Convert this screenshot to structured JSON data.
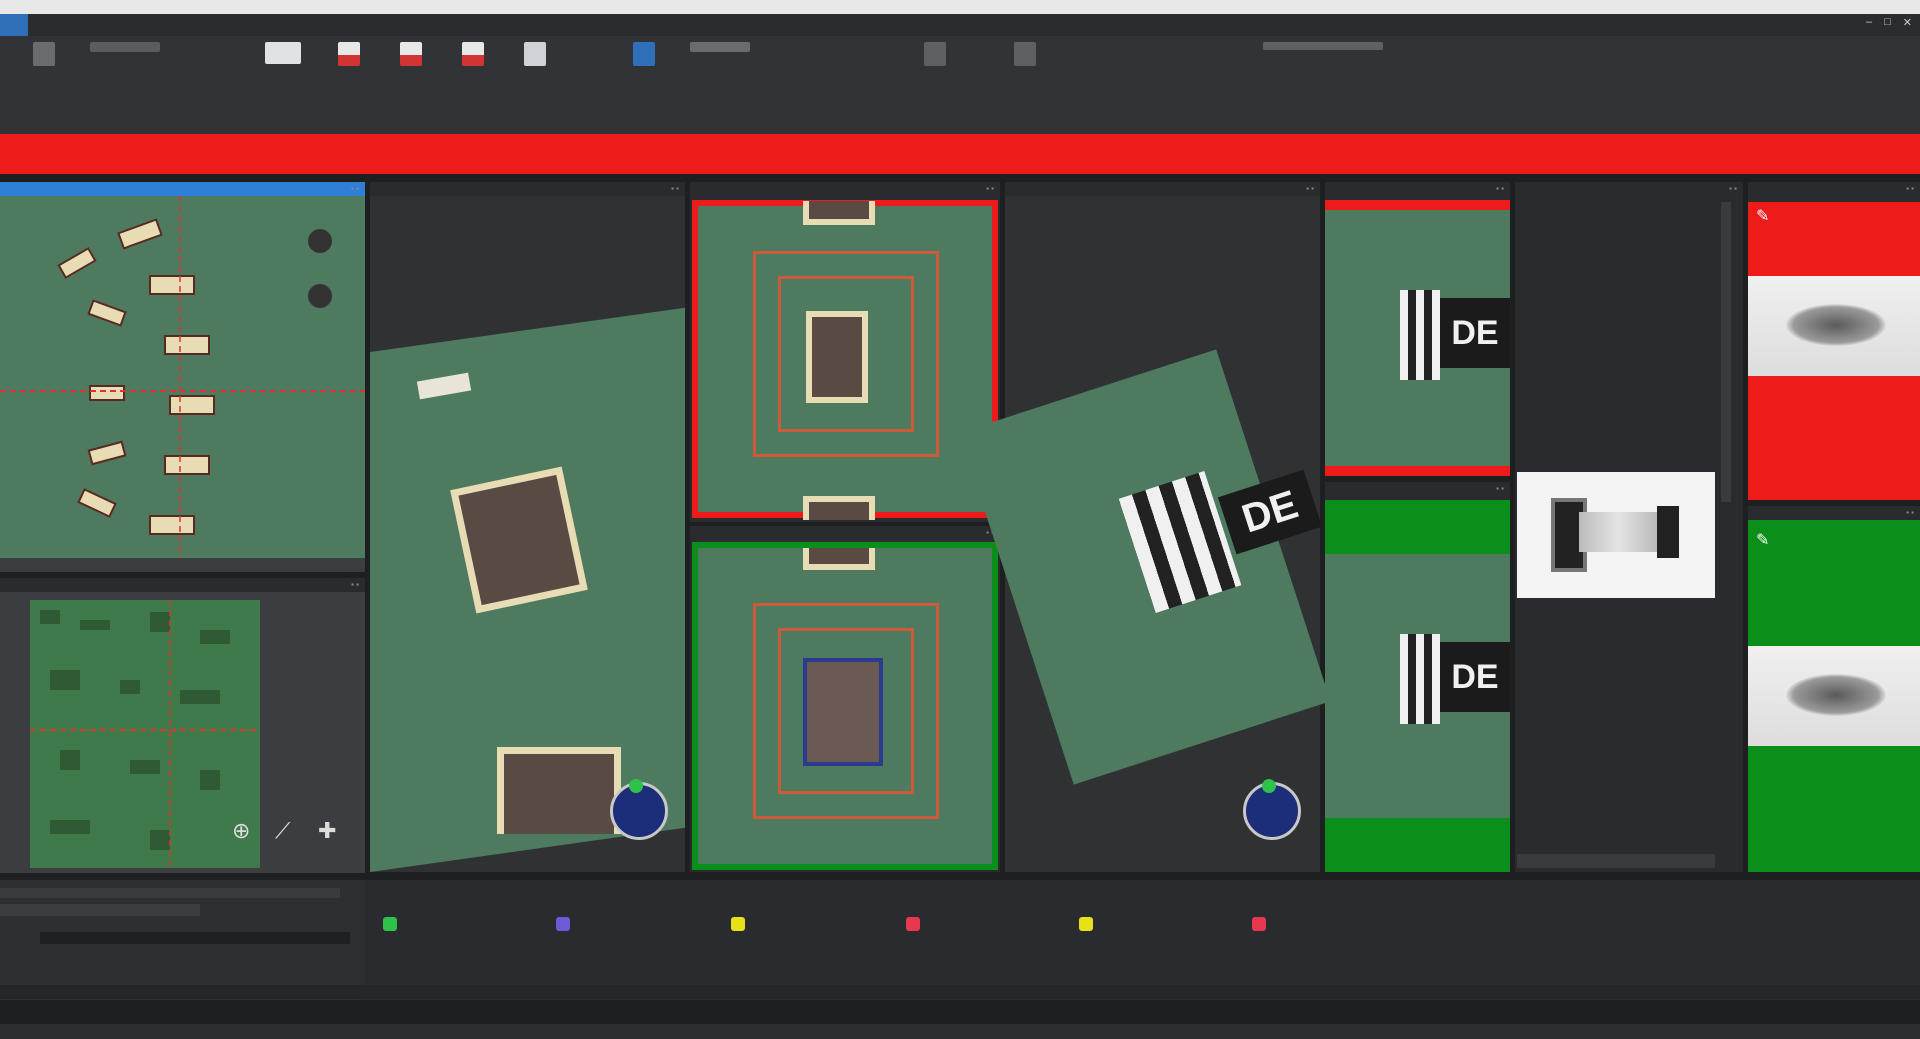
{
  "window": {
    "title": "",
    "controls": [
      "–",
      "□",
      "✕"
    ]
  },
  "menu": {
    "tabs": [
      "",
      "",
      "",
      ""
    ]
  },
  "ribbon": {
    "groups": [
      {
        "label": ""
      },
      {
        "label": ""
      },
      {
        "label": ""
      },
      {
        "label": ""
      }
    ],
    "buttons": [
      "",
      "",
      "",
      "",
      "",
      "",
      "",
      "",
      "",
      "",
      "",
      ""
    ]
  },
  "alert": {
    "text": ""
  },
  "panels": {
    "overview": {
      "title": ""
    },
    "board_map": {
      "title": ""
    },
    "view1": {
      "title": ""
    },
    "view2_top": {
      "title": ""
    },
    "view2_bottom": {
      "title": ""
    },
    "view3": {
      "title": ""
    },
    "view4_top": {
      "title": ""
    },
    "view4_bottom": {
      "title": ""
    },
    "view5": {
      "title": ""
    },
    "view6_top": {
      "title": ""
    },
    "view6_bottom": {
      "title": ""
    }
  },
  "component": {
    "marking": "DE"
  },
  "status": {
    "colors": {
      "green": "#2ec24a",
      "purple": "#6b5bd6",
      "yellow": "#e6e21a",
      "red": "#e8384f",
      "alert": "#ee1b1b",
      "pass": "#0b8f1a"
    }
  }
}
